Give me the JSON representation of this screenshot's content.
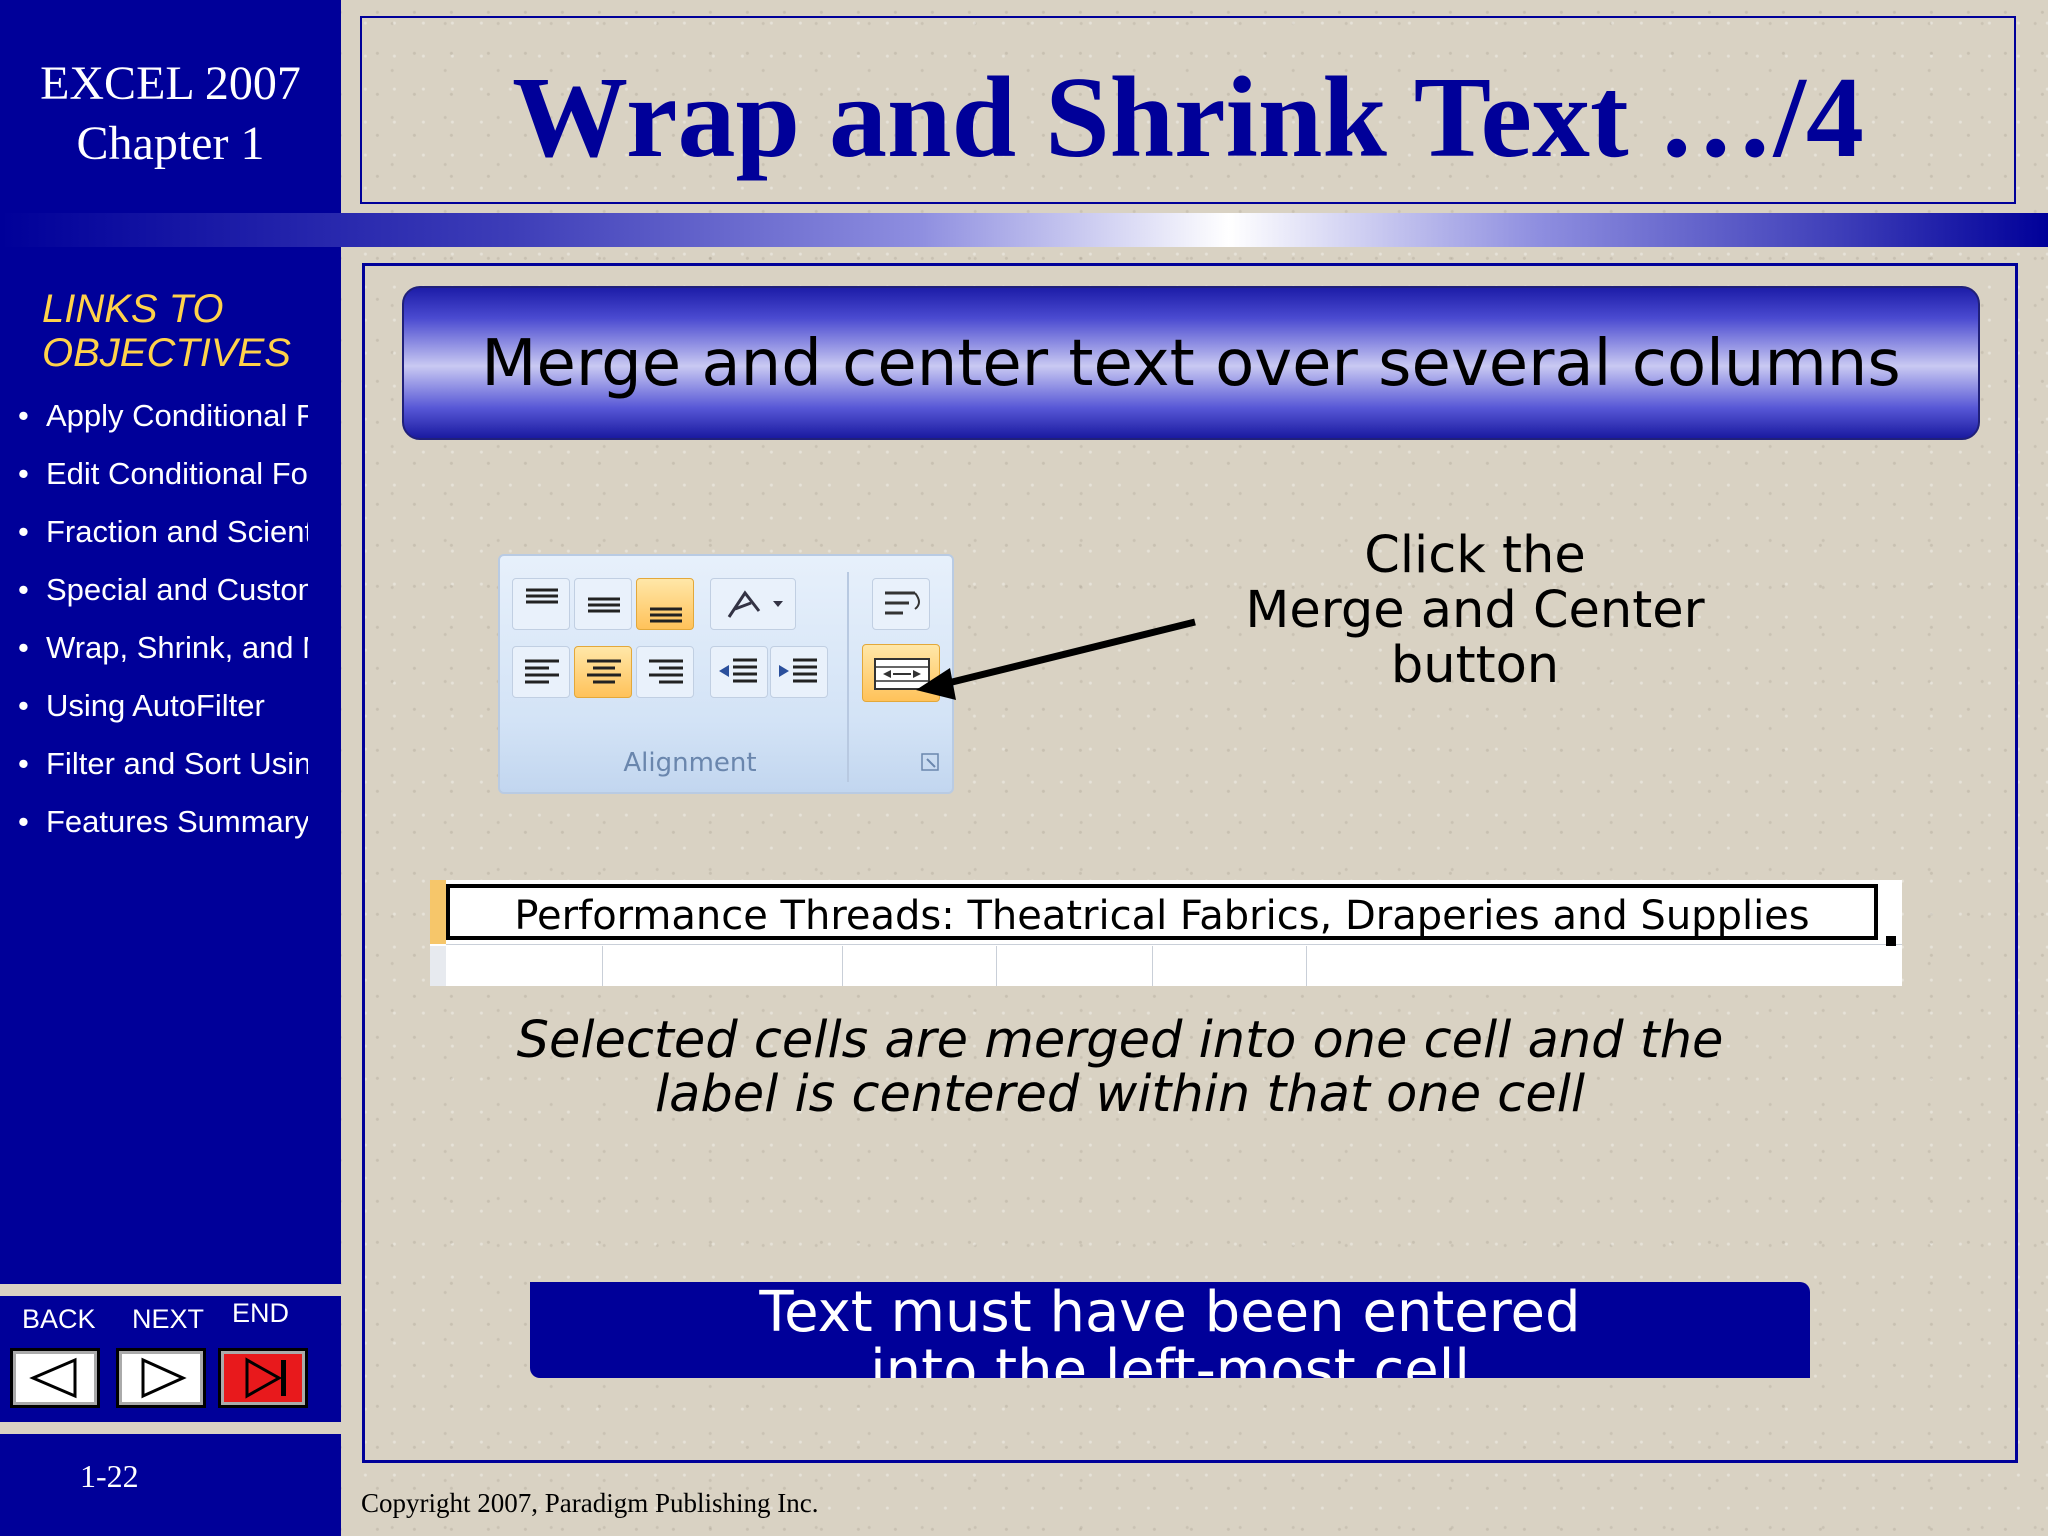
{
  "header": {
    "course_line1": "EXCEL 2007",
    "course_line2": "Chapter 1",
    "slide_title": "Wrap and Shrink Text …/4"
  },
  "sidebar": {
    "heading_line1": "LINKS TO",
    "heading_line2": "OBJECTIVES",
    "items": [
      {
        "label": "Apply Conditional Fo"
      },
      {
        "label": "Edit Conditional Form"
      },
      {
        "label": "Fraction and Scientifi"
      },
      {
        "label": "Special and Custom"
      },
      {
        "label": "Wrap, Shrink, and Me"
      },
      {
        "label": "Using AutoFilter"
      },
      {
        "label": "Filter and Sort Using"
      },
      {
        "label": "Features Summary"
      }
    ]
  },
  "nav": {
    "back_label": "BACK",
    "next_label": "NEXT",
    "end_label": "END",
    "back_icon": "triangle-left-icon",
    "next_icon": "triangle-right-icon",
    "end_icon": "skip-end-icon"
  },
  "page_number": "1-22",
  "main": {
    "banner_text": "Merge and center text over several columns",
    "ribbon_group_label": "Alignment",
    "callout_line1": "Click the",
    "callout_line2": "Merge and Center",
    "callout_line3": "button",
    "merged_cell_text": "Performance Threads: Theatrical Fabrics, Draperies and Supplies",
    "note_line1": "Selected cells are merged into one cell and the",
    "note_line2": "label is centered within that one cell",
    "tip_line1": "Text must have been entered",
    "tip_line2": "into the left-most cell"
  },
  "footer": {
    "copyright": "Copyright 2007, Paradigm Publishing Inc."
  },
  "colors": {
    "navy": "#000099",
    "link_heading": "#ffd24a",
    "end_button": "#e8191c",
    "highlight": "#ffc25a"
  }
}
